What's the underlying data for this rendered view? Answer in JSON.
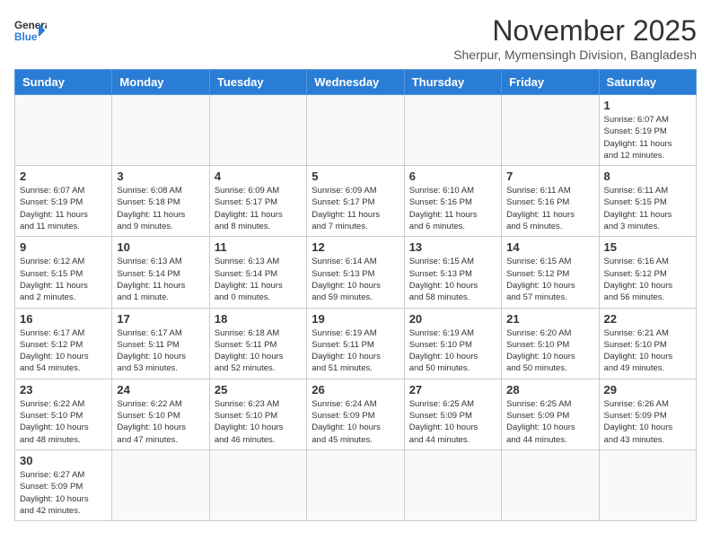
{
  "header": {
    "logo_general": "General",
    "logo_blue": "Blue",
    "month_title": "November 2025",
    "subtitle": "Sherpur, Mymensingh Division, Bangladesh"
  },
  "weekdays": [
    "Sunday",
    "Monday",
    "Tuesday",
    "Wednesday",
    "Thursday",
    "Friday",
    "Saturday"
  ],
  "weeks": [
    [
      {
        "day": "",
        "info": ""
      },
      {
        "day": "",
        "info": ""
      },
      {
        "day": "",
        "info": ""
      },
      {
        "day": "",
        "info": ""
      },
      {
        "day": "",
        "info": ""
      },
      {
        "day": "",
        "info": ""
      },
      {
        "day": "1",
        "info": "Sunrise: 6:07 AM\nSunset: 5:19 PM\nDaylight: 11 hours\nand 12 minutes."
      }
    ],
    [
      {
        "day": "2",
        "info": "Sunrise: 6:07 AM\nSunset: 5:19 PM\nDaylight: 11 hours\nand 11 minutes."
      },
      {
        "day": "3",
        "info": "Sunrise: 6:08 AM\nSunset: 5:18 PM\nDaylight: 11 hours\nand 9 minutes."
      },
      {
        "day": "4",
        "info": "Sunrise: 6:09 AM\nSunset: 5:17 PM\nDaylight: 11 hours\nand 8 minutes."
      },
      {
        "day": "5",
        "info": "Sunrise: 6:09 AM\nSunset: 5:17 PM\nDaylight: 11 hours\nand 7 minutes."
      },
      {
        "day": "6",
        "info": "Sunrise: 6:10 AM\nSunset: 5:16 PM\nDaylight: 11 hours\nand 6 minutes."
      },
      {
        "day": "7",
        "info": "Sunrise: 6:11 AM\nSunset: 5:16 PM\nDaylight: 11 hours\nand 5 minutes."
      },
      {
        "day": "8",
        "info": "Sunrise: 6:11 AM\nSunset: 5:15 PM\nDaylight: 11 hours\nand 3 minutes."
      }
    ],
    [
      {
        "day": "9",
        "info": "Sunrise: 6:12 AM\nSunset: 5:15 PM\nDaylight: 11 hours\nand 2 minutes."
      },
      {
        "day": "10",
        "info": "Sunrise: 6:13 AM\nSunset: 5:14 PM\nDaylight: 11 hours\nand 1 minute."
      },
      {
        "day": "11",
        "info": "Sunrise: 6:13 AM\nSunset: 5:14 PM\nDaylight: 11 hours\nand 0 minutes."
      },
      {
        "day": "12",
        "info": "Sunrise: 6:14 AM\nSunset: 5:13 PM\nDaylight: 10 hours\nand 59 minutes."
      },
      {
        "day": "13",
        "info": "Sunrise: 6:15 AM\nSunset: 5:13 PM\nDaylight: 10 hours\nand 58 minutes."
      },
      {
        "day": "14",
        "info": "Sunrise: 6:15 AM\nSunset: 5:12 PM\nDaylight: 10 hours\nand 57 minutes."
      },
      {
        "day": "15",
        "info": "Sunrise: 6:16 AM\nSunset: 5:12 PM\nDaylight: 10 hours\nand 56 minutes."
      }
    ],
    [
      {
        "day": "16",
        "info": "Sunrise: 6:17 AM\nSunset: 5:12 PM\nDaylight: 10 hours\nand 54 minutes."
      },
      {
        "day": "17",
        "info": "Sunrise: 6:17 AM\nSunset: 5:11 PM\nDaylight: 10 hours\nand 53 minutes."
      },
      {
        "day": "18",
        "info": "Sunrise: 6:18 AM\nSunset: 5:11 PM\nDaylight: 10 hours\nand 52 minutes."
      },
      {
        "day": "19",
        "info": "Sunrise: 6:19 AM\nSunset: 5:11 PM\nDaylight: 10 hours\nand 51 minutes."
      },
      {
        "day": "20",
        "info": "Sunrise: 6:19 AM\nSunset: 5:10 PM\nDaylight: 10 hours\nand 50 minutes."
      },
      {
        "day": "21",
        "info": "Sunrise: 6:20 AM\nSunset: 5:10 PM\nDaylight: 10 hours\nand 50 minutes."
      },
      {
        "day": "22",
        "info": "Sunrise: 6:21 AM\nSunset: 5:10 PM\nDaylight: 10 hours\nand 49 minutes."
      }
    ],
    [
      {
        "day": "23",
        "info": "Sunrise: 6:22 AM\nSunset: 5:10 PM\nDaylight: 10 hours\nand 48 minutes."
      },
      {
        "day": "24",
        "info": "Sunrise: 6:22 AM\nSunset: 5:10 PM\nDaylight: 10 hours\nand 47 minutes."
      },
      {
        "day": "25",
        "info": "Sunrise: 6:23 AM\nSunset: 5:10 PM\nDaylight: 10 hours\nand 46 minutes."
      },
      {
        "day": "26",
        "info": "Sunrise: 6:24 AM\nSunset: 5:09 PM\nDaylight: 10 hours\nand 45 minutes."
      },
      {
        "day": "27",
        "info": "Sunrise: 6:25 AM\nSunset: 5:09 PM\nDaylight: 10 hours\nand 44 minutes."
      },
      {
        "day": "28",
        "info": "Sunrise: 6:25 AM\nSunset: 5:09 PM\nDaylight: 10 hours\nand 44 minutes."
      },
      {
        "day": "29",
        "info": "Sunrise: 6:26 AM\nSunset: 5:09 PM\nDaylight: 10 hours\nand 43 minutes."
      }
    ],
    [
      {
        "day": "30",
        "info": "Sunrise: 6:27 AM\nSunset: 5:09 PM\nDaylight: 10 hours\nand 42 minutes."
      },
      {
        "day": "",
        "info": ""
      },
      {
        "day": "",
        "info": ""
      },
      {
        "day": "",
        "info": ""
      },
      {
        "day": "",
        "info": ""
      },
      {
        "day": "",
        "info": ""
      },
      {
        "day": "",
        "info": ""
      }
    ]
  ]
}
